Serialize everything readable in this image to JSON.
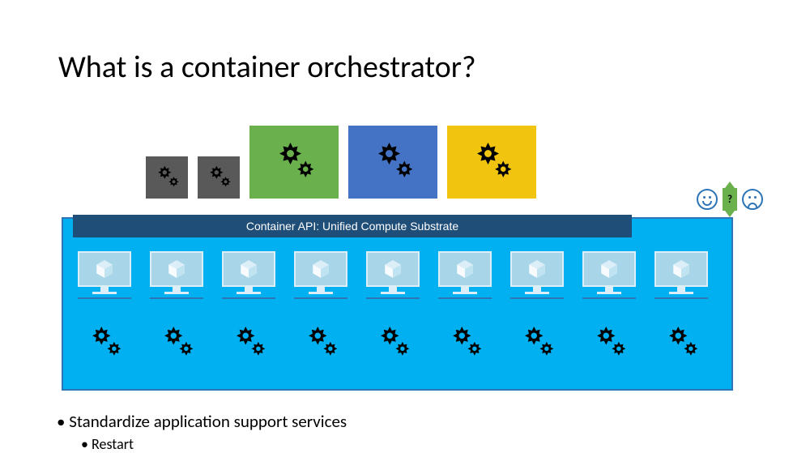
{
  "title": "What is a container orchestrator?",
  "apiBar": "Container API: Unified Compute Substrate",
  "question": "?",
  "bullet1": "• Standardize application support services",
  "bullet2": "• Restart",
  "colors": {
    "green": "#6ab04c",
    "blue": "#4472c4",
    "yellow": "#f1c40f",
    "cyan": "#00b0f0",
    "darkBlue": "#1f4e79",
    "gray": "#595959"
  },
  "nodeCount": 9,
  "topSmallTiles": 2,
  "topBigTiles": [
    "green",
    "blue",
    "yellow"
  ]
}
